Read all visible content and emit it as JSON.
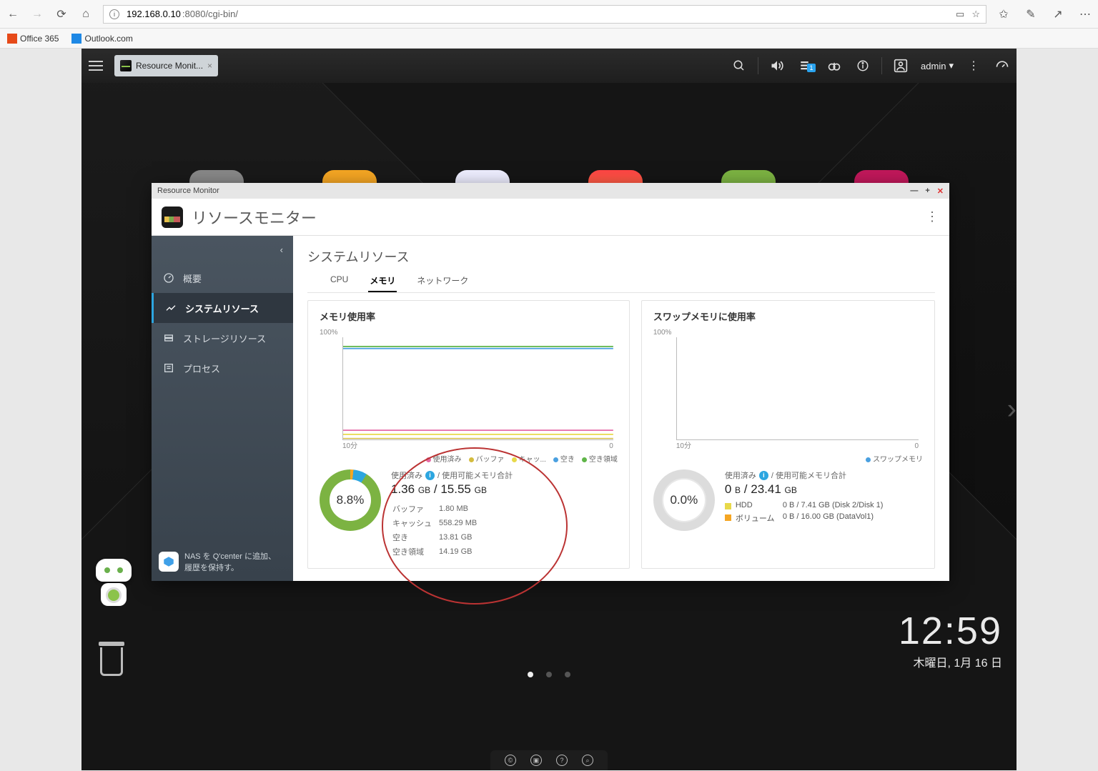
{
  "browser": {
    "url_host": "192.168.0.10",
    "url_portpath": ":8080/cgi-bin/",
    "bookmarks": [
      {
        "label": "Office 365",
        "color": "#e64a19"
      },
      {
        "label": "Outlook.com",
        "color": "#1e88e5"
      }
    ]
  },
  "nas_topbar": {
    "task_tab": "Resource Monit...",
    "user": "admin",
    "notif_badge": "1"
  },
  "desktop": {
    "clock_time": "12:59",
    "clock_date": "木曜日, 1月 16 日",
    "side_tip_line1": "NAS を Q'center に追加、",
    "side_tip_line2": "履歴を保持す。"
  },
  "window": {
    "titlebar": "Resource Monitor",
    "app_title": "リソースモニター",
    "section_title": "システムリソース",
    "sidebar": {
      "items": [
        {
          "label": "概要"
        },
        {
          "label": "システムリソース"
        },
        {
          "label": "ストレージリソース"
        },
        {
          "label": "プロセス"
        }
      ]
    },
    "tabs": [
      {
        "label": "CPU"
      },
      {
        "label": "メモリ"
      },
      {
        "label": "ネットワーク"
      }
    ],
    "mem_panel": {
      "title": "メモリ使用率",
      "y100": "100%",
      "x_left": "10分",
      "x_right": "0",
      "legend": {
        "used": "使用済み",
        "buffer": "バッファ",
        "cache": "キャッ...",
        "free": "空き",
        "freespace": "空き領域"
      },
      "percent": "8.8%",
      "stat_header_used": "使用済み",
      "stat_header_total": "/ 使用可能メモリ合計",
      "used_val": "1.36",
      "used_unit": "GB",
      "total_val": "15.55",
      "total_unit": "GB",
      "rows": [
        {
          "k": "バッファ",
          "v": "1.80 MB"
        },
        {
          "k": "キャッシュ",
          "v": "558.29 MB"
        },
        {
          "k": "空き",
          "v": "13.81 GB"
        },
        {
          "k": "空き領域",
          "v": "14.19 GB"
        }
      ]
    },
    "swap_panel": {
      "title": "スワップメモリに使用率",
      "y100": "100%",
      "x_left": "10分",
      "x_right": "0",
      "legend": {
        "swap": "スワップメモリ"
      },
      "percent": "0.0%",
      "stat_header_used": "使用済み",
      "stat_header_total": "/ 使用可能メモリ合計",
      "used_val": "0",
      "used_unit": "B",
      "total_val": "23.41",
      "total_unit": "GB",
      "hdd_label": "HDD",
      "hdd_val": "0 B / 7.41 GB (Disk 2/Disk 1)",
      "vol_label": "ボリューム",
      "vol_val": "0 B / 16.00 GB (DataVol1)"
    }
  },
  "chart_data": [
    {
      "type": "line",
      "title": "メモリ使用率",
      "xlabel": "10分",
      "ylabel": "%",
      "ylim": [
        0,
        100
      ],
      "series": [
        {
          "name": "使用済み",
          "approx_pct": 9,
          "color": "#e66aa5"
        },
        {
          "name": "バッファ",
          "approx_pct": 0,
          "color": "#d4bc3e"
        },
        {
          "name": "キャッシュ",
          "approx_pct": 4,
          "color": "#e8d94a"
        },
        {
          "name": "空き",
          "approx_pct": 89,
          "color": "#4aa0e0"
        },
        {
          "name": "空き領域",
          "approx_pct": 91,
          "color": "#5fb548"
        }
      ],
      "note": "all series are flat horizontal lines across the time window"
    },
    {
      "type": "line",
      "title": "スワップメモリに使用率",
      "xlabel": "10分",
      "ylabel": "%",
      "ylim": [
        0,
        100
      ],
      "series": [
        {
          "name": "スワップメモリ",
          "approx_pct": 0,
          "color": "#4aa0e0"
        }
      ],
      "note": "empty — 0% usage"
    },
    {
      "type": "pie",
      "title": "メモリ使用率 donut",
      "slices": [
        {
          "name": "使用済み 8.8%",
          "value": 8.8,
          "color_outer": "#2da6e0",
          "color_inner": "#7cb342"
        },
        {
          "name": "残り 91.2%",
          "value": 91.2
        }
      ]
    }
  ]
}
